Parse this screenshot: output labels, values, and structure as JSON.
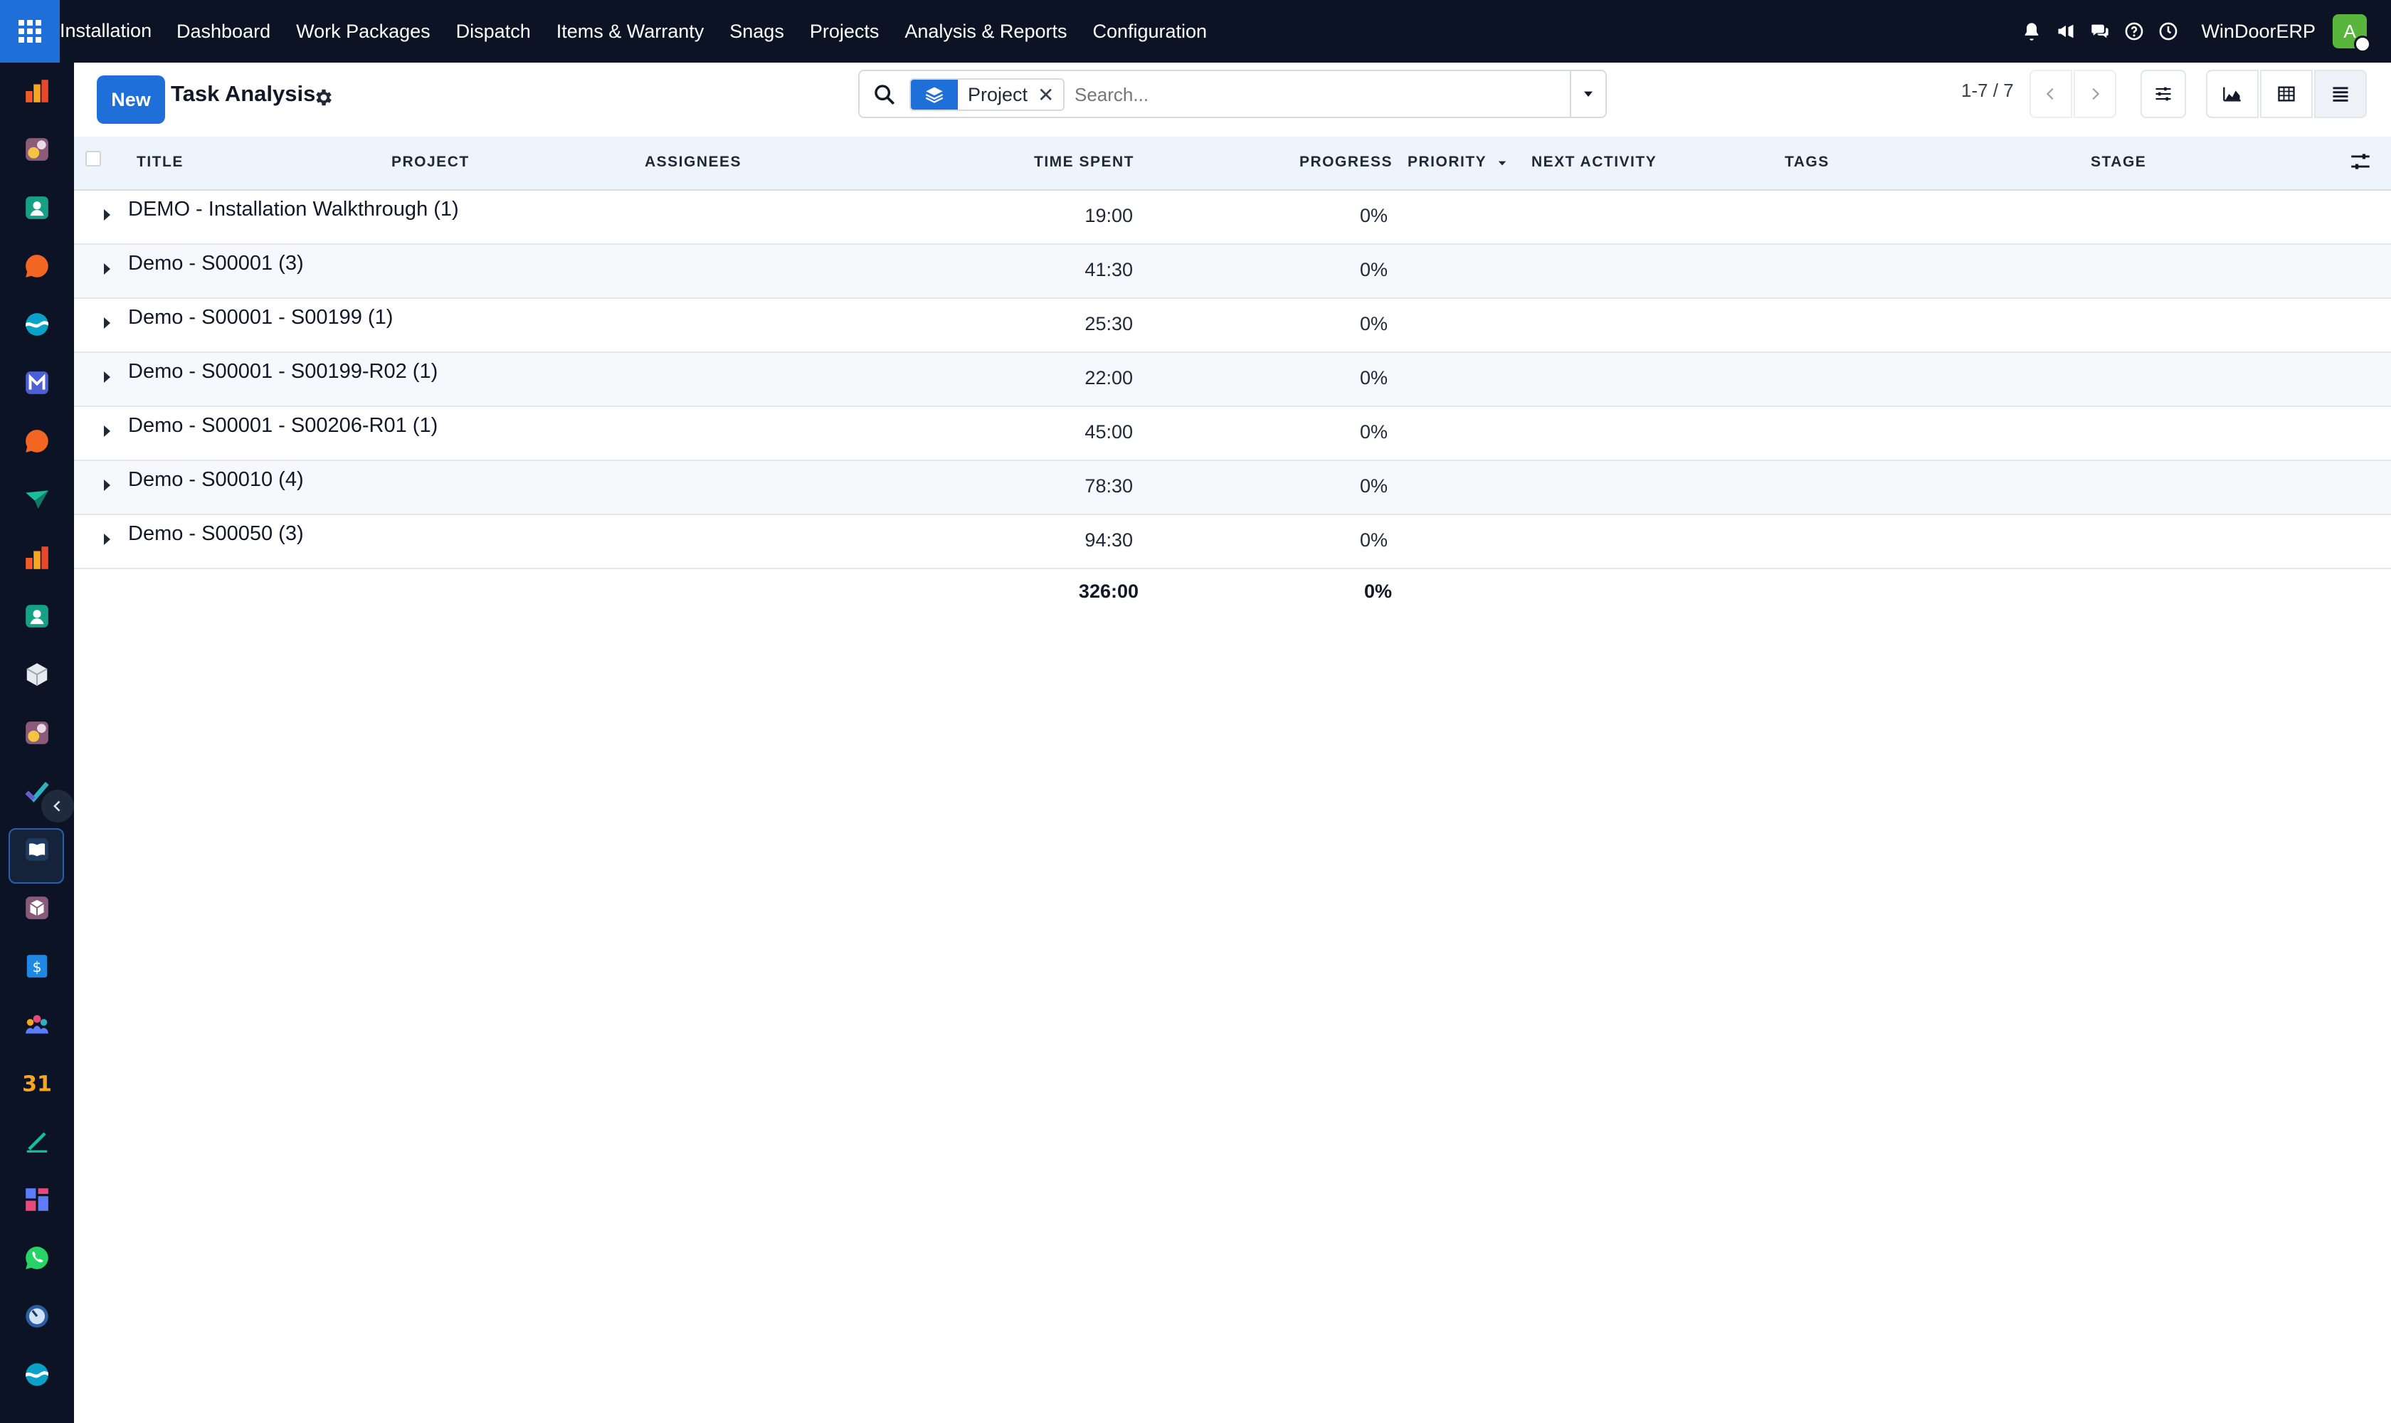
{
  "topbar": {
    "app_name": "Installation",
    "menu": [
      "Dashboard",
      "Work Packages",
      "Dispatch",
      "Items & Warranty",
      "Snags",
      "Projects",
      "Analysis & Reports",
      "Configuration"
    ],
    "company": "WinDoorERP",
    "avatar_initial": "A"
  },
  "sidebar": {
    "apps": [
      "bar-chart-icon",
      "cube-star-icon",
      "contact-card-icon",
      "chat-bubble-icon",
      "wave-icon",
      "mail-icon",
      "chat-bubble-icon",
      "paper-plane-icon",
      "bar-chart-icon",
      "contact-card-icon",
      "package-icon",
      "cube-star-icon",
      "project-check-icon",
      "book-icon",
      "box-icon",
      "invoice-icon",
      "team-icon",
      "calendar-icon",
      "sign-icon",
      "dashboard-icon",
      "whatsapp-icon",
      "timer-icon",
      "wave-icon"
    ],
    "active_index": 12
  },
  "control": {
    "new_label": "New",
    "title": "Task Analysis",
    "search": {
      "facet": "Project",
      "placeholder": "Search..."
    },
    "pager": "1-7 / 7"
  },
  "table": {
    "columns": {
      "title": "TITLE",
      "project": "PROJECT",
      "assignees": "ASSIGNEES",
      "time_spent": "TIME SPENT",
      "progress": "PROGRESS",
      "priority": "PRIORITY",
      "next_activity": "NEXT ACTIVITY",
      "tags": "TAGS",
      "stage": "STAGE"
    },
    "groups": [
      {
        "name": "DEMO - Installation Walkthrough (1)",
        "time_spent": "19:00",
        "progress": "0%"
      },
      {
        "name": "Demo - S00001 (3)",
        "time_spent": "41:30",
        "progress": "0%"
      },
      {
        "name": "Demo - S00001 - S00199 (1)",
        "time_spent": "25:30",
        "progress": "0%"
      },
      {
        "name": "Demo - S00001 - S00199-R02 (1)",
        "time_spent": "22:00",
        "progress": "0%"
      },
      {
        "name": "Demo - S00001 - S00206-R01 (1)",
        "time_spent": "45:00",
        "progress": "0%"
      },
      {
        "name": "Demo - S00010 (4)",
        "time_spent": "78:30",
        "progress": "0%"
      },
      {
        "name": "Demo - S00050 (3)",
        "time_spent": "94:30",
        "progress": "0%"
      }
    ],
    "totals": {
      "time_spent": "326:00",
      "progress": "0%"
    }
  },
  "colors": {
    "topbar": "#0b1324",
    "accent": "#1f6fd8",
    "header_bg": "#eef4fb",
    "avatar": "#5ab53c"
  }
}
